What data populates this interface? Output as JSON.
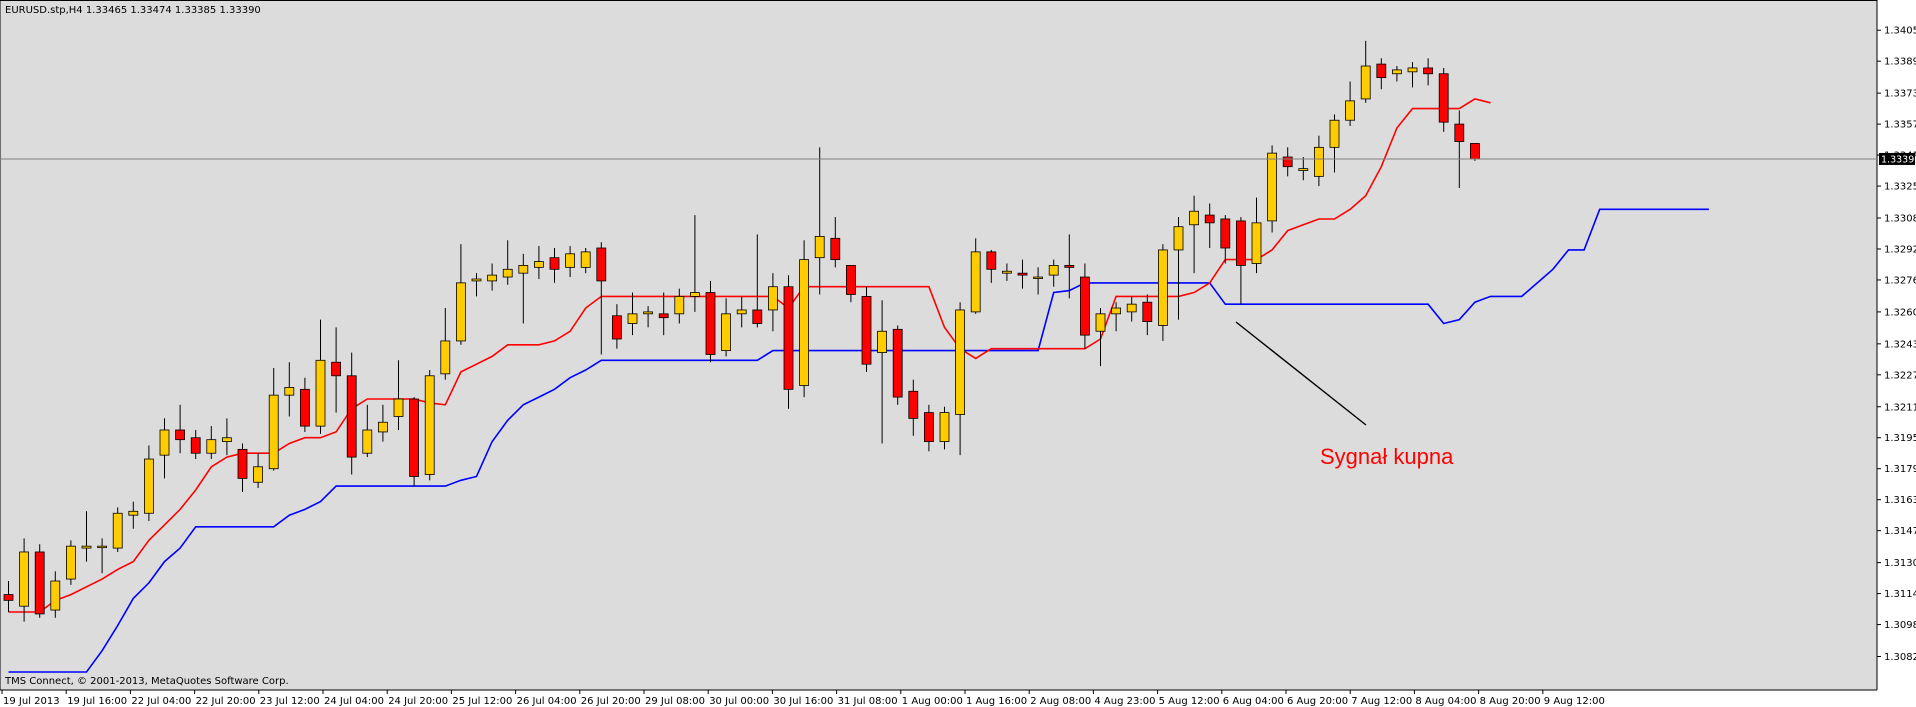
{
  "header": {
    "symbol_text": "EURUSD.stp,H4  1.33465 1.33474 1.33385 1.33390"
  },
  "copyright": "TMS Connect, © 2001-2013, MetaQuotes Software Corp.",
  "annotation": "Sygnał kupna",
  "current_price_label": "1.33390",
  "colors": {
    "plot_bg": "#dcdcdc",
    "bull": "#ffcc00",
    "bear": "#ff0000",
    "tenkan": "#ff0000",
    "kijun": "#0000ff",
    "wick": "#000000",
    "price_line": "#808080"
  },
  "chart_data": {
    "type": "candlestick",
    "symbol": "EURUSD.stp",
    "timeframe": "H4",
    "ylim": [
      1.3074,
      1.3418
    ],
    "y_ticks": [
      "1.34055",
      "1.33895",
      "1.33730",
      "1.33570",
      "1.33410",
      "1.33250",
      "1.33085",
      "1.32925",
      "1.32765",
      "1.32600",
      "1.32435",
      "1.32275",
      "1.32110",
      "1.31950",
      "1.31790",
      "1.31630",
      "1.31470",
      "1.31305",
      "1.31145",
      "1.30985",
      "1.30820"
    ],
    "x_labels": [
      "19 Jul 2013",
      "19 Jul 16:00",
      "22 Jul 04:00",
      "22 Jul 20:00",
      "23 Jul 12:00",
      "24 Jul 04:00",
      "24 Jul 20:00",
      "25 Jul 12:00",
      "26 Jul 04:00",
      "26 Jul 20:00",
      "29 Jul 08:00",
      "30 Jul 00:00",
      "30 Jul 16:00",
      "31 Jul 08:00",
      "1 Aug 00:00",
      "1 Aug 16:00",
      "2 Aug 08:00",
      "4 Aug 23:00",
      "5 Aug 12:00",
      "6 Aug 04:00",
      "6 Aug 20:00",
      "7 Aug 12:00",
      "8 Aug 04:00",
      "8 Aug 20:00",
      "9 Aug 12:00"
    ],
    "current_price": 1.3339,
    "candles": [
      [
        1.3114,
        1.3111,
        1.3121,
        1.3105
      ],
      [
        1.3108,
        1.3136,
        1.3143,
        1.31
      ],
      [
        1.3136,
        1.3104,
        1.314,
        1.3102
      ],
      [
        1.3106,
        1.3121,
        1.3126,
        1.3102
      ],
      [
        1.3122,
        1.3139,
        1.3142,
        1.3119
      ],
      [
        1.3138,
        1.3139,
        1.3157,
        1.3131
      ],
      [
        1.3139,
        1.3139,
        1.3143,
        1.3125
      ],
      [
        1.3138,
        1.3156,
        1.3159,
        1.3136
      ],
      [
        1.3155,
        1.3157,
        1.3162,
        1.3148
      ],
      [
        1.3156,
        1.3184,
        1.3191,
        1.3152
      ],
      [
        1.3186,
        1.3199,
        1.3205,
        1.3174
      ],
      [
        1.3199,
        1.3194,
        1.3212,
        1.3187
      ],
      [
        1.3195,
        1.3187,
        1.3199,
        1.3184
      ],
      [
        1.3187,
        1.3194,
        1.3201,
        1.3184
      ],
      [
        1.3193,
        1.3195,
        1.3205,
        1.3186
      ],
      [
        1.3189,
        1.3174,
        1.3192,
        1.3167
      ],
      [
        1.3172,
        1.318,
        1.3187,
        1.3169
      ],
      [
        1.3179,
        1.3217,
        1.3231,
        1.3178
      ],
      [
        1.3217,
        1.3221,
        1.3234,
        1.3206
      ],
      [
        1.322,
        1.3201,
        1.3226,
        1.3198
      ],
      [
        1.3201,
        1.3235,
        1.3256,
        1.3197
      ],
      [
        1.3234,
        1.3227,
        1.3252,
        1.3208
      ],
      [
        1.3227,
        1.3185,
        1.3239,
        1.3176
      ],
      [
        1.3187,
        1.3199,
        1.3212,
        1.3185
      ],
      [
        1.3198,
        1.3203,
        1.3212,
        1.3193
      ],
      [
        1.3206,
        1.3215,
        1.3235,
        1.3199
      ],
      [
        1.3215,
        1.3175,
        1.3216,
        1.317
      ],
      [
        1.3176,
        1.3227,
        1.323,
        1.3173
      ],
      [
        1.3228,
        1.3245,
        1.3262,
        1.3225
      ],
      [
        1.3245,
        1.3275,
        1.3295,
        1.3243
      ],
      [
        1.3276,
        1.3277,
        1.328,
        1.3268
      ],
      [
        1.3276,
        1.3279,
        1.3285,
        1.3271
      ],
      [
        1.3278,
        1.3282,
        1.3297,
        1.3274
      ],
      [
        1.328,
        1.3284,
        1.329,
        1.3254
      ],
      [
        1.3283,
        1.3286,
        1.3294,
        1.3277
      ],
      [
        1.3288,
        1.3282,
        1.3293,
        1.3275
      ],
      [
        1.3283,
        1.329,
        1.3294,
        1.3278
      ],
      [
        1.3283,
        1.3291,
        1.3293,
        1.328
      ],
      [
        1.3293,
        1.3276,
        1.3296,
        1.3238
      ],
      [
        1.3258,
        1.3246,
        1.3264,
        1.3241
      ],
      [
        1.3254,
        1.3259,
        1.327,
        1.3248
      ],
      [
        1.3259,
        1.326,
        1.3263,
        1.3252
      ],
      [
        1.3259,
        1.3257,
        1.327,
        1.3248
      ],
      [
        1.3259,
        1.3268,
        1.3272,
        1.3254
      ],
      [
        1.3268,
        1.327,
        1.331,
        1.326
      ],
      [
        1.327,
        1.3238,
        1.3276,
        1.3234
      ],
      [
        1.324,
        1.3259,
        1.3267,
        1.3237
      ],
      [
        1.3259,
        1.3261,
        1.3268,
        1.3252
      ],
      [
        1.3261,
        1.3254,
        1.33,
        1.3252
      ],
      [
        1.3261,
        1.3273,
        1.328,
        1.325
      ],
      [
        1.3273,
        1.322,
        1.3279,
        1.321
      ],
      [
        1.3222,
        1.3287,
        1.3297,
        1.3216
      ],
      [
        1.3288,
        1.3299,
        1.3345,
        1.3269
      ],
      [
        1.3298,
        1.3287,
        1.3309,
        1.3283
      ],
      [
        1.3284,
        1.3269,
        1.3276,
        1.3265
      ],
      [
        1.3268,
        1.3233,
        1.3273,
        1.3229
      ],
      [
        1.3239,
        1.325,
        1.3266,
        1.3192
      ],
      [
        1.3251,
        1.3216,
        1.3253,
        1.3212
      ],
      [
        1.3219,
        1.3205,
        1.3225,
        1.3196
      ],
      [
        1.3208,
        1.3193,
        1.3212,
        1.3188
      ],
      [
        1.3193,
        1.3208,
        1.3211,
        1.3189
      ],
      [
        1.3207,
        1.3261,
        1.3265,
        1.3186
      ],
      [
        1.326,
        1.3291,
        1.3298,
        1.3259
      ],
      [
        1.3291,
        1.3282,
        1.3292,
        1.3275
      ],
      [
        1.328,
        1.3281,
        1.3285,
        1.3276
      ],
      [
        1.328,
        1.3279,
        1.3287,
        1.3272
      ],
      [
        1.3278,
        1.3278,
        1.3283,
        1.3269
      ],
      [
        1.3279,
        1.3284,
        1.3287,
        1.3273
      ],
      [
        1.3284,
        1.3283,
        1.33,
        1.3267
      ],
      [
        1.3278,
        1.3248,
        1.3285,
        1.3241
      ],
      [
        1.325,
        1.3259,
        1.3262,
        1.3232
      ],
      [
        1.3259,
        1.3262,
        1.3265,
        1.325
      ],
      [
        1.326,
        1.3264,
        1.3268,
        1.3255
      ],
      [
        1.3265,
        1.3255,
        1.3269,
        1.3248
      ],
      [
        1.3253,
        1.3292,
        1.3295,
        1.3245
      ],
      [
        1.3292,
        1.3304,
        1.3309,
        1.3256
      ],
      [
        1.3305,
        1.3312,
        1.332,
        1.328
      ],
      [
        1.331,
        1.3306,
        1.3316,
        1.3293
      ],
      [
        1.3308,
        1.3293,
        1.331,
        1.3285
      ],
      [
        1.3307,
        1.3284,
        1.3309,
        1.3264
      ],
      [
        1.3285,
        1.3306,
        1.3319,
        1.328
      ],
      [
        1.3307,
        1.3342,
        1.3346,
        1.3301
      ],
      [
        1.334,
        1.3335,
        1.3345,
        1.333
      ],
      [
        1.3333,
        1.3334,
        1.334,
        1.3328
      ],
      [
        1.333,
        1.3345,
        1.3351,
        1.3325
      ],
      [
        1.3345,
        1.3359,
        1.3362,
        1.3332
      ],
      [
        1.3359,
        1.3369,
        1.3379,
        1.3356
      ],
      [
        1.337,
        1.3387,
        1.34,
        1.3368
      ],
      [
        1.3388,
        1.3381,
        1.3391,
        1.3375
      ],
      [
        1.3383,
        1.3385,
        1.3387,
        1.3379
      ],
      [
        1.3384,
        1.3386,
        1.3389,
        1.3376
      ],
      [
        1.3386,
        1.3383,
        1.3391,
        1.3377
      ],
      [
        1.3383,
        1.3358,
        1.3386,
        1.3353
      ],
      [
        1.3357,
        1.3348,
        1.3364,
        1.3324
      ],
      [
        1.3347,
        1.3339,
        1.3347,
        1.3338
      ]
    ],
    "tenkan": [
      1.3105,
      1.3105,
      1.3105,
      1.3111,
      1.3114,
      1.3118,
      1.3122,
      1.3127,
      1.3131,
      1.3142,
      1.315,
      1.3158,
      1.3168,
      1.318,
      1.3185,
      1.3187,
      1.3187,
      1.3187,
      1.3192,
      1.3195,
      1.3195,
      1.3198,
      1.321,
      1.3215,
      1.3215,
      1.3215,
      1.3215,
      1.3213,
      1.3212,
      1.3229,
      1.3233,
      1.3237,
      1.3243,
      1.3243,
      1.3243,
      1.3245,
      1.325,
      1.3262,
      1.3268,
      1.3268,
      1.3268,
      1.3268,
      1.3268,
      1.3268,
      1.3268,
      1.3268,
      1.3268,
      1.3268,
      1.3268,
      1.3268,
      1.3262,
      1.3273,
      1.3273,
      1.3273,
      1.3273,
      1.3273,
      1.3273,
      1.3273,
      1.3273,
      1.3273,
      1.3252,
      1.3241,
      1.3236,
      1.3241,
      1.3241,
      1.3241,
      1.3241,
      1.3241,
      1.3241,
      1.3241,
      1.3246,
      1.3268,
      1.3268,
      1.3268,
      1.3268,
      1.3268,
      1.327,
      1.3275,
      1.3287,
      1.3287,
      1.3287,
      1.3292,
      1.3302,
      1.3305,
      1.3308,
      1.3308,
      1.3313,
      1.332,
      1.3335,
      1.3355,
      1.3365,
      1.3365,
      1.3365,
      1.3365,
      1.337,
      1.3368
    ],
    "kijun": [
      1.3074,
      1.3074,
      1.3074,
      1.3074,
      1.3074,
      1.3074,
      1.3085,
      1.3098,
      1.3112,
      1.312,
      1.3131,
      1.3138,
      1.3149,
      1.3149,
      1.3149,
      1.3149,
      1.3149,
      1.3149,
      1.3155,
      1.3158,
      1.3162,
      1.317,
      1.317,
      1.317,
      1.317,
      1.317,
      1.317,
      1.317,
      1.317,
      1.3173,
      1.3175,
      1.3193,
      1.3204,
      1.3212,
      1.3216,
      1.322,
      1.3226,
      1.323,
      1.3235,
      1.3235,
      1.3235,
      1.3235,
      1.3235,
      1.3235,
      1.3235,
      1.3235,
      1.3235,
      1.3235,
      1.3235,
      1.324,
      1.324,
      1.324,
      1.324,
      1.324,
      1.324,
      1.324,
      1.324,
      1.324,
      1.324,
      1.324,
      1.324,
      1.324,
      1.324,
      1.324,
      1.324,
      1.324,
      1.324,
      1.327,
      1.3271,
      1.3275,
      1.3275,
      1.3275,
      1.3275,
      1.3275,
      1.3275,
      1.3275,
      1.3275,
      1.3275,
      1.3264,
      1.3264,
      1.3264,
      1.3264,
      1.3264,
      1.3264,
      1.3264,
      1.3264,
      1.3264,
      1.3264,
      1.3264,
      1.3264,
      1.3264,
      1.3264,
      1.3254,
      1.3256,
      1.3265,
      1.3268,
      1.3268,
      1.3268,
      1.3275,
      1.3282,
      1.3292,
      1.3292,
      1.3313,
      1.3313,
      1.3313,
      1.3313,
      1.3313,
      1.3313,
      1.3313,
      1.3313
    ]
  }
}
